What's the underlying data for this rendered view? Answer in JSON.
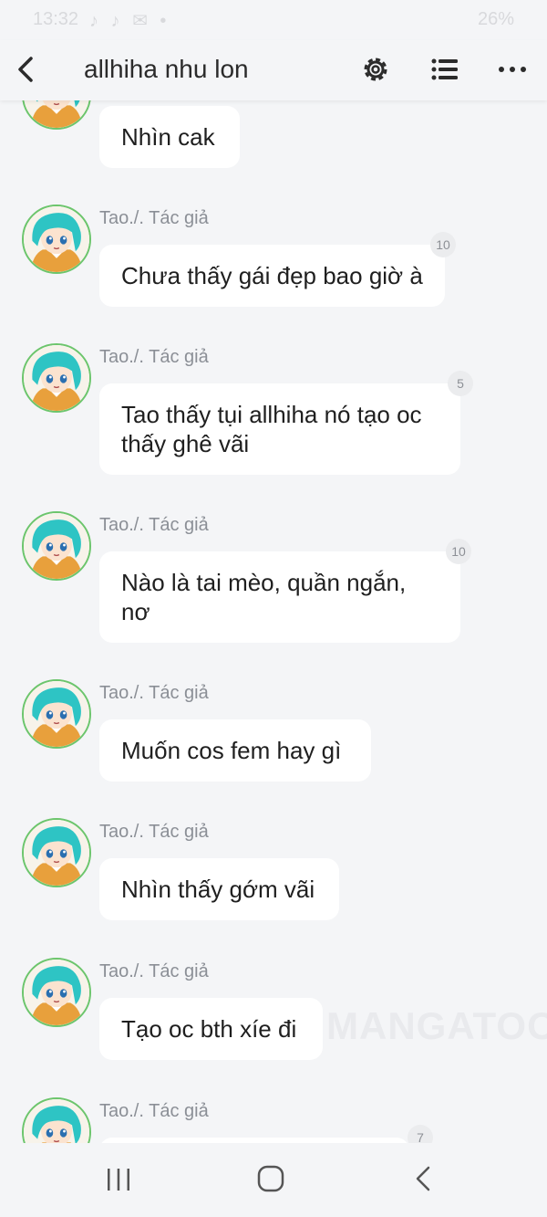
{
  "status_bar": {
    "time": "13:32",
    "notification_icons": "♪ ♪ ✉ •",
    "battery": "26%"
  },
  "header": {
    "title": "allhiha nhu lon",
    "icons": [
      "back-icon",
      "settings-icon",
      "list-icon",
      "more-icon"
    ]
  },
  "messages": [
    {
      "author": "",
      "text": "Nhìn cak",
      "badge": ""
    },
    {
      "author": "Tao./. Tác giả",
      "text": "Chưa thấy gái đẹp bao giờ à",
      "badge": "10"
    },
    {
      "author": "Tao./. Tác giả",
      "text": "Tao thấy tụi allhiha nó tạo oc thấy ghê vãi",
      "badge": "5"
    },
    {
      "author": "Tao./. Tác giả",
      "text": "Nào là tai mèo, quần ngắn, nơ",
      "badge": "10"
    },
    {
      "author": "Tao./. Tác giả",
      "text": "Muốn cos fem hay gì",
      "badge": ""
    },
    {
      "author": "Tao./. Tác giả",
      "text": "Nhìn thấy gớm vãi",
      "badge": ""
    },
    {
      "author": "Tao./. Tác giả",
      "text": "Tạo oc bth xíe đi",
      "badge": ""
    },
    {
      "author": "Tao./. Tác giả",
      "text": "",
      "badge": "7"
    }
  ],
  "watermark": "MANGATOON",
  "nav_bar": {
    "icons": [
      "recent-apps-icon",
      "home-icon",
      "back-icon"
    ]
  },
  "colors": {
    "background": "#f4f5f7",
    "bubble": "#ffffff",
    "avatar_hair": "#2ec4c4",
    "avatar_border": "#6cc56c"
  }
}
